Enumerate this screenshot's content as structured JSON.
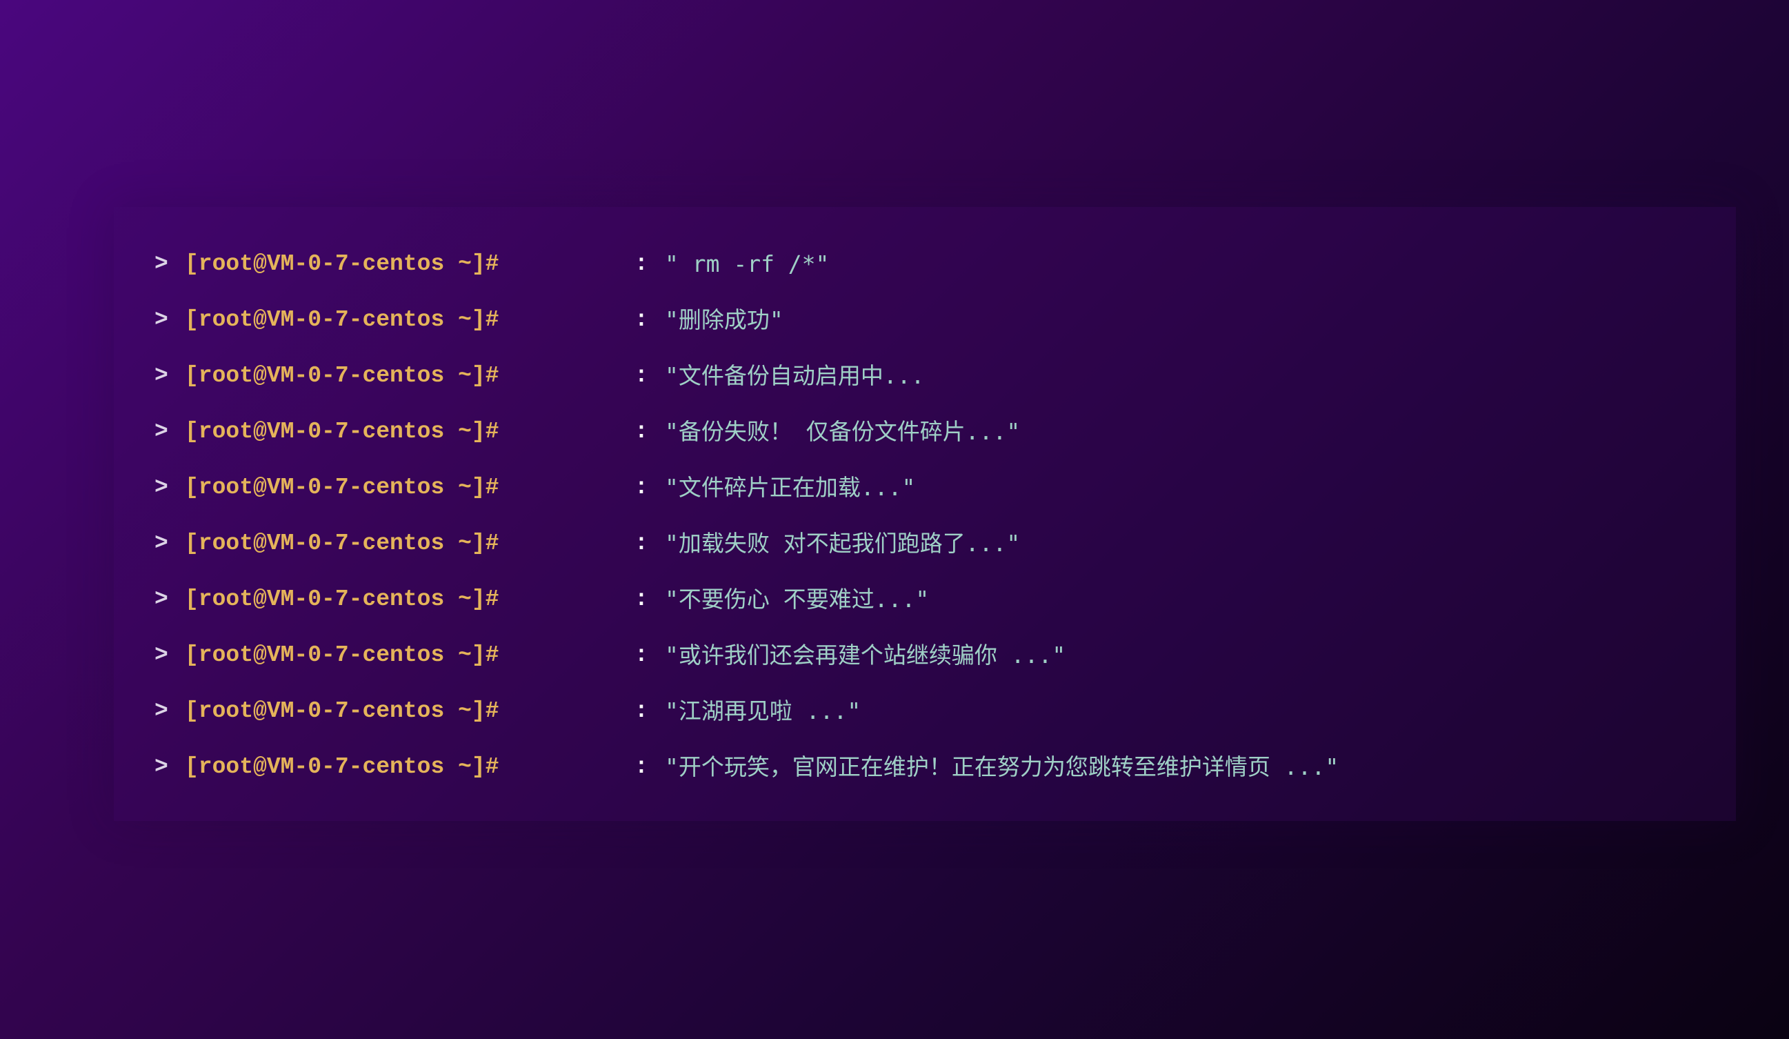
{
  "terminal": {
    "arrow": ">",
    "prompt": "[root@VM-0-7-centos ~]#",
    "separator": ":",
    "lines": [
      {
        "message": "\" rm -rf /*\""
      },
      {
        "message": "\"删除成功\""
      },
      {
        "message": "\"文件备份自动启用中..."
      },
      {
        "message": "\"备份失败！ 仅备份文件碎片...\""
      },
      {
        "message": "\"文件碎片正在加载...\""
      },
      {
        "message": "\"加载失败 对不起我们跑路了...\""
      },
      {
        "message": "\"不要伤心 不要难过...\""
      },
      {
        "message": "\"或许我们还会再建个站继续骗你 ...\""
      },
      {
        "message": "\"江湖再见啦 ...\""
      },
      {
        "message": "\"开个玩笑，官网正在维护！正在努力为您跳转至维护详情页 ...\""
      }
    ]
  },
  "colors": {
    "prompt": "#e5b45a",
    "message": "#9fd0c6",
    "arrow": "#dcd4e6",
    "background_start": "#4a067e",
    "background_end": "#0a0212"
  }
}
